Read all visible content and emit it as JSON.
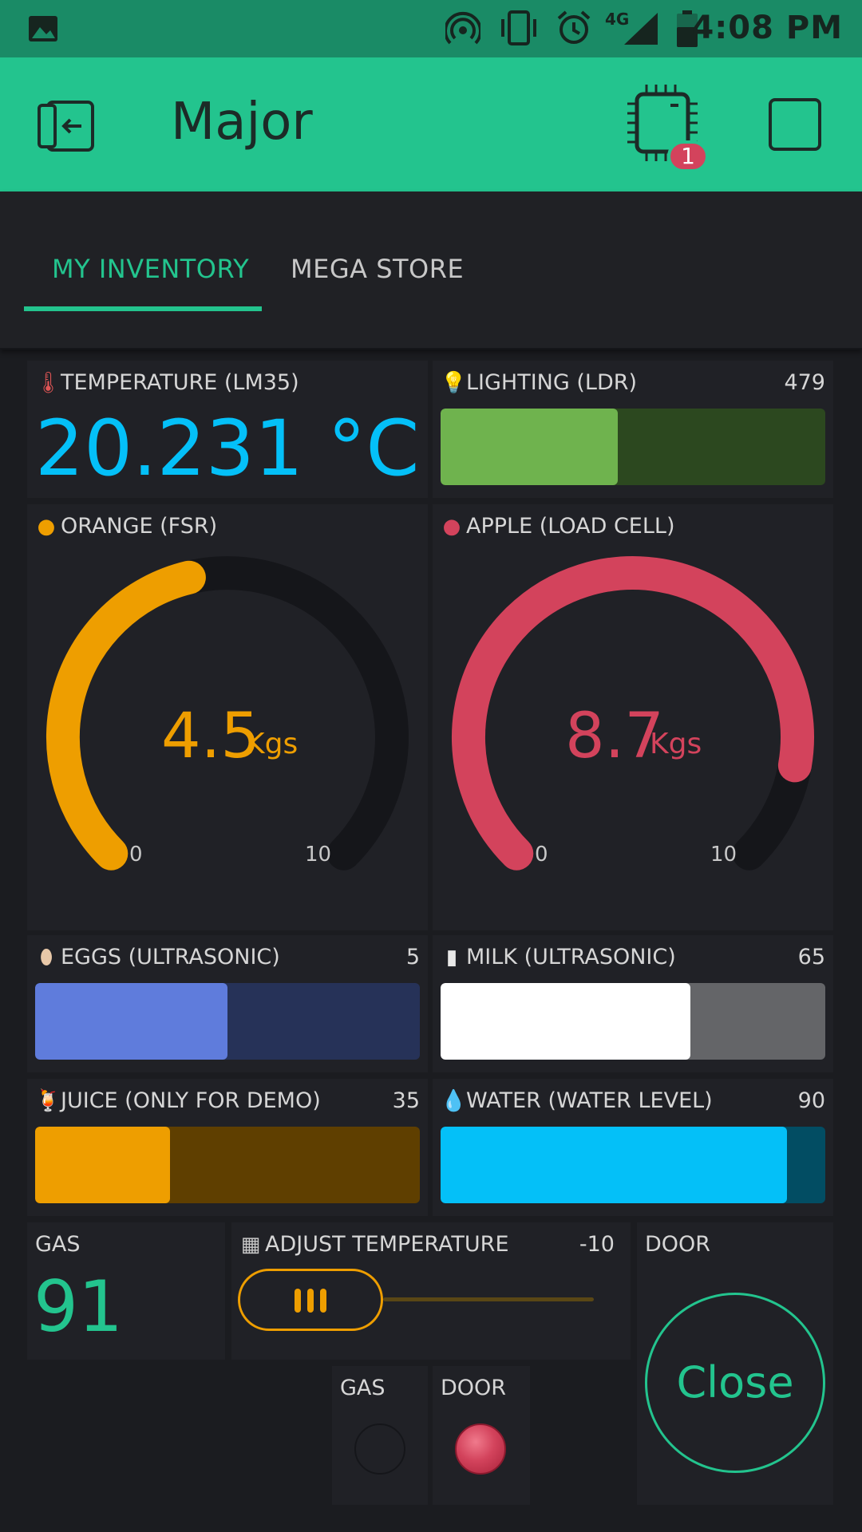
{
  "status_bar": {
    "time": "4:08 PM",
    "network": "4G"
  },
  "header": {
    "title": "Major",
    "device_badge": "1"
  },
  "tabs": [
    {
      "label": "MY INVENTORY",
      "active": true
    },
    {
      "label": "MEGA STORE",
      "active": false
    }
  ],
  "widgets": {
    "temperature": {
      "label": "TEMPERATURE (LM35)",
      "value": "20.231 °C",
      "icon": "thermometer-icon"
    },
    "lighting": {
      "label": "LIGHTING (LDR)",
      "value": "479",
      "level": 0.46,
      "icon": "lightbulb-icon",
      "color": "#6fb34e"
    },
    "orange": {
      "label": "ORANGE (FSR)",
      "value": "4.5",
      "unit": "Kgs",
      "min": "0",
      "max": "10",
      "level": 0.45,
      "icon": "orange-icon",
      "color": "#ee9e00"
    },
    "apple": {
      "label": "APPLE (LOAD CELL)",
      "value": "8.7",
      "unit": "Kgs",
      "min": "0",
      "max": "10",
      "level": 0.87,
      "icon": "apple-icon",
      "color": "#d3435c"
    },
    "eggs": {
      "label": "EGGS (ULTRASONIC)",
      "value": "5",
      "level": 0.5,
      "icon": "egg-icon",
      "color": "#5f7cdc"
    },
    "milk": {
      "label": "MILK (ULTRASONIC)",
      "value": "65",
      "level": 0.65,
      "icon": "milk-glass-icon",
      "color": "#ffffff"
    },
    "juice": {
      "label": "JUICE (ONLY FOR DEMO)",
      "value": "35",
      "level": 0.35,
      "icon": "juice-icon",
      "color": "#ee9e00"
    },
    "water": {
      "label": "WATER (WATER LEVEL)",
      "value": "90",
      "level": 0.9,
      "icon": "water-drop-icon",
      "color": "#04c0f8"
    },
    "gas": {
      "label": "GAS",
      "value": "91",
      "color": "#23c48e"
    },
    "adjust_temperature": {
      "label": "ADJUST TEMPERATURE",
      "value": "-10",
      "icon": "stove-icon",
      "color": "#ee9e00"
    },
    "door": {
      "label": "DOOR",
      "button_label": "Close",
      "color": "#23c48e"
    },
    "gas_led": {
      "label": "GAS",
      "state": "off"
    },
    "door_led": {
      "label": "DOOR",
      "state": "on",
      "color": "#d3435c"
    }
  }
}
